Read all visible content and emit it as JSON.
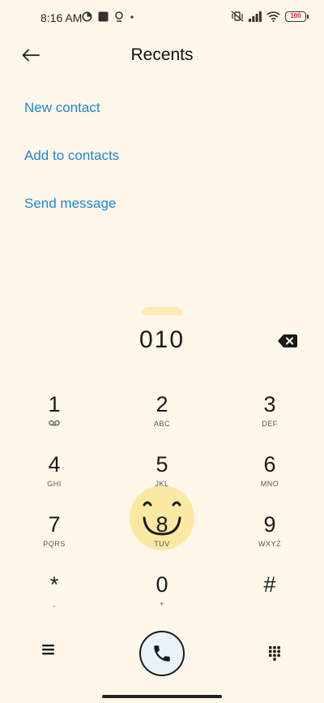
{
  "status_bar": {
    "time": "8:16 AM",
    "battery": "100"
  },
  "header": {
    "title": "Recents"
  },
  "actions": [
    {
      "label": "New contact"
    },
    {
      "label": "Add to contacts"
    },
    {
      "label": "Send message"
    }
  ],
  "dialer": {
    "number": "010"
  },
  "keypad": [
    {
      "digit": "1",
      "letters": ""
    },
    {
      "digit": "2",
      "letters": "ABC"
    },
    {
      "digit": "3",
      "letters": "DEF"
    },
    {
      "digit": "4",
      "letters": "GHI"
    },
    {
      "digit": "5",
      "letters": "JKL"
    },
    {
      "digit": "6",
      "letters": "MNO"
    },
    {
      "digit": "7",
      "letters": "PQRS"
    },
    {
      "digit": "8",
      "letters": "TUV"
    },
    {
      "digit": "9",
      "letters": "WXYZ"
    },
    {
      "digit": "*",
      "letters": ","
    },
    {
      "digit": "0",
      "letters": "+"
    },
    {
      "digit": "#",
      "letters": ""
    }
  ],
  "colors": {
    "background": "#FFF7EA",
    "accent": "#1E86D6",
    "highlight": "#FBE9A3"
  },
  "icons": {
    "back": "arrow-left-icon",
    "backspace": "backspace-icon",
    "voicemail": "voicemail-icon",
    "menu": "menu-icon",
    "call": "phone-icon",
    "keypad": "dialpad-icon"
  }
}
